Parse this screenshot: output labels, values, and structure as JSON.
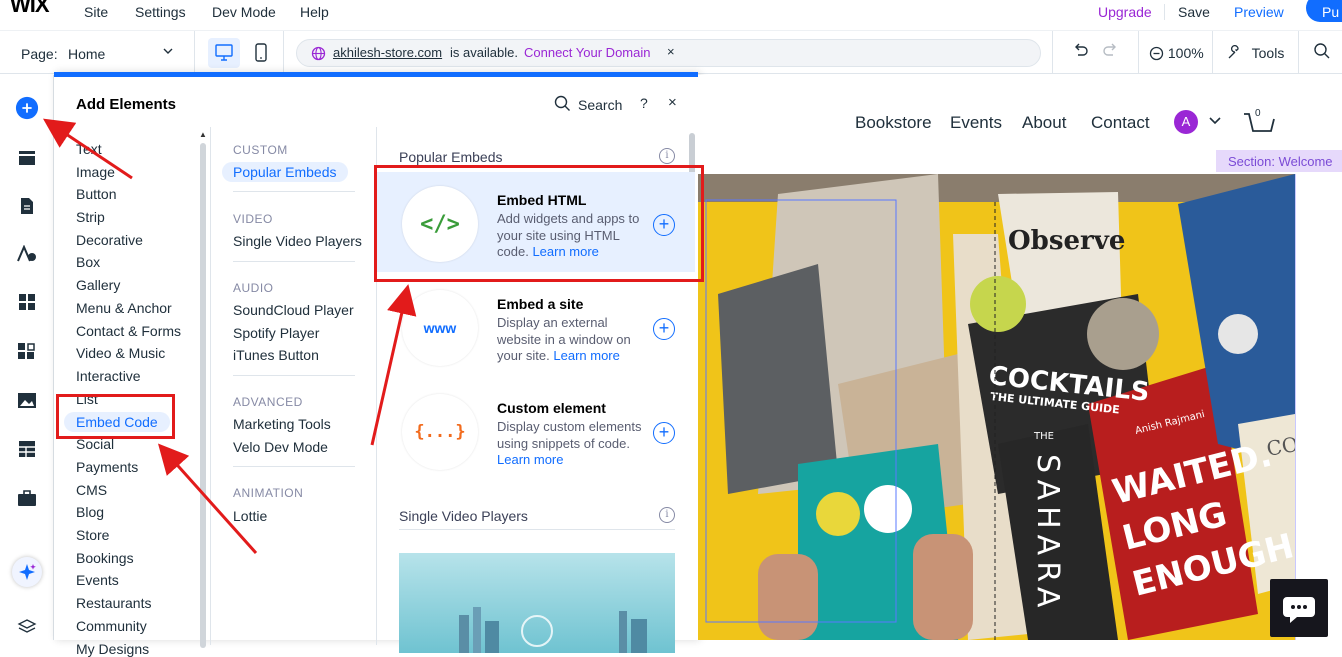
{
  "menubar": {
    "logo": "WIX",
    "items": [
      "Site",
      "Settings",
      "Dev Mode",
      "Help"
    ],
    "upgrade": "Upgrade",
    "save": "Save",
    "preview": "Preview",
    "publish": "Pu"
  },
  "toolbar": {
    "page_label": "Page:",
    "page_value": "Home",
    "domain_name": "akhilesh-store.com",
    "domain_status": "is available.",
    "domain_link": "Connect Your Domain",
    "domain_close": "×",
    "zoom": "100%",
    "tools": "Tools"
  },
  "panel": {
    "title": "Add Elements",
    "search_label": "Search",
    "help": "?",
    "close": "×",
    "categories": [
      "Text",
      "Image",
      "Button",
      "Strip",
      "Decorative",
      "Box",
      "Gallery",
      "Menu & Anchor",
      "Contact & Forms",
      "Video & Music",
      "Interactive",
      "List",
      "Embed Code",
      "Social",
      "Payments",
      "CMS",
      "Blog",
      "Store",
      "Bookings",
      "Events",
      "Restaurants",
      "Community",
      "My Designs"
    ],
    "active_category": "Embed Code",
    "subgroups": [
      {
        "heading": "CUSTOM",
        "items": [
          "Popular Embeds"
        ]
      },
      {
        "heading": "VIDEO",
        "items": [
          "Single Video Players"
        ]
      },
      {
        "heading": "AUDIO",
        "items": [
          "SoundCloud Player",
          "Spotify Player",
          "iTunes Button"
        ]
      },
      {
        "heading": "ADVANCED",
        "items": [
          "Marketing Tools",
          "Velo Dev Mode"
        ]
      },
      {
        "heading": "ANIMATION",
        "items": [
          "Lottie"
        ]
      }
    ],
    "content": {
      "section1": "Popular Embeds",
      "section2": "Single Video Players",
      "learn_more": "Learn more",
      "cards": [
        {
          "title": "Embed HTML",
          "desc": "Add widgets and apps to your site using HTML code.",
          "icon": "code-tag-icon",
          "icon_text": "</>",
          "icon_color": "#3a9c3a"
        },
        {
          "title": "Embed a site",
          "desc": "Display an external website in a window on your site.",
          "icon": "www-icon",
          "icon_text": "www",
          "icon_color": "#116dff"
        },
        {
          "title": "Custom element",
          "desc": "Display custom elements using snippets of code.",
          "icon": "braces-icon",
          "icon_text": "{...}",
          "icon_color": "#f26b1d"
        }
      ]
    }
  },
  "site": {
    "nav": [
      "Bookstore",
      "Events",
      "About",
      "Contact"
    ],
    "avatar_initial": "A",
    "cart_count": "0",
    "section_label": "Section: Welcome",
    "books": {
      "observe": "Observe",
      "cocktails": "COCKTAILS",
      "cocktails_sub": "THE ULTIMATE GUIDE",
      "the": "THE",
      "sahara": "SAHARA",
      "author": "Anish Rajmani",
      "waited": "WAITED.",
      "long": "LONG",
      "enough": "ENOUGH",
      "col": "COL"
    }
  },
  "colors": {
    "accent": "#116dff",
    "annotation": "#e21b1b",
    "hero_bg": "#f0c419",
    "upgrade": "#9a27d5"
  }
}
